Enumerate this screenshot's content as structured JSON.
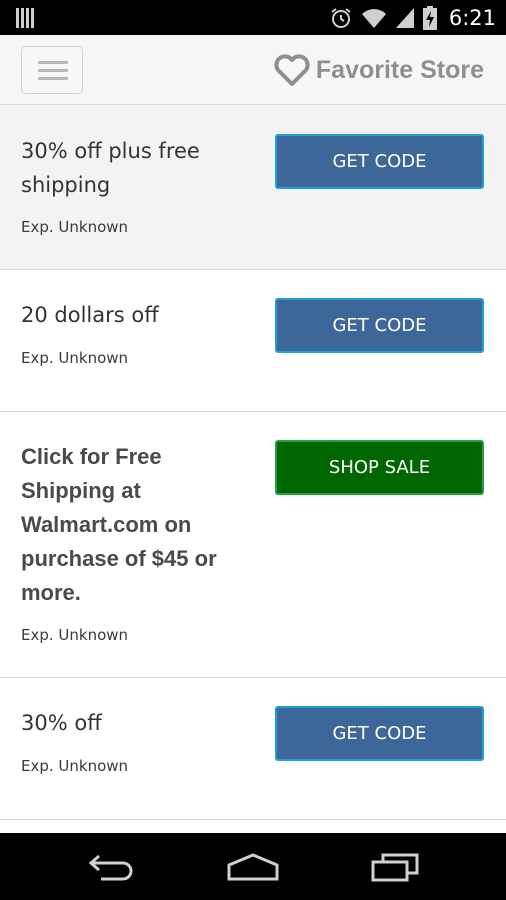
{
  "status_bar": {
    "time": "6:21",
    "icons": [
      "sim-icon",
      "alarm-icon",
      "wifi-icon",
      "signal-icon",
      "battery-charging-icon"
    ]
  },
  "header": {
    "menu_icon": "hamburger-menu-icon",
    "favorite_icon": "heart-outline-icon",
    "favorite_label": "Favorite Store"
  },
  "offers": [
    {
      "title": "30% off plus free shipping",
      "expiry": "Exp. Unknown",
      "button": "GET CODE",
      "style": "code"
    },
    {
      "title": "20 dollars off",
      "expiry": "Exp. Unknown",
      "button": "GET CODE",
      "style": "code"
    },
    {
      "title": "Click for Free Shipping at Walmart.com on purchase of $45 or more.",
      "expiry": "Exp. Unknown",
      "button": "SHOP SALE",
      "style": "sale"
    },
    {
      "title": "30% off",
      "expiry": "Exp. Unknown",
      "button": "GET CODE",
      "style": "code"
    }
  ],
  "colors": {
    "code_button": "#3d6699",
    "code_button_border": "#1fa1d8",
    "sale_button": "#006600",
    "header_bg": "#f6f6f6",
    "highlight_row": "#f3f3f3"
  },
  "nav_bar": {
    "icons": [
      "back-icon",
      "home-icon",
      "recent-apps-icon"
    ]
  }
}
